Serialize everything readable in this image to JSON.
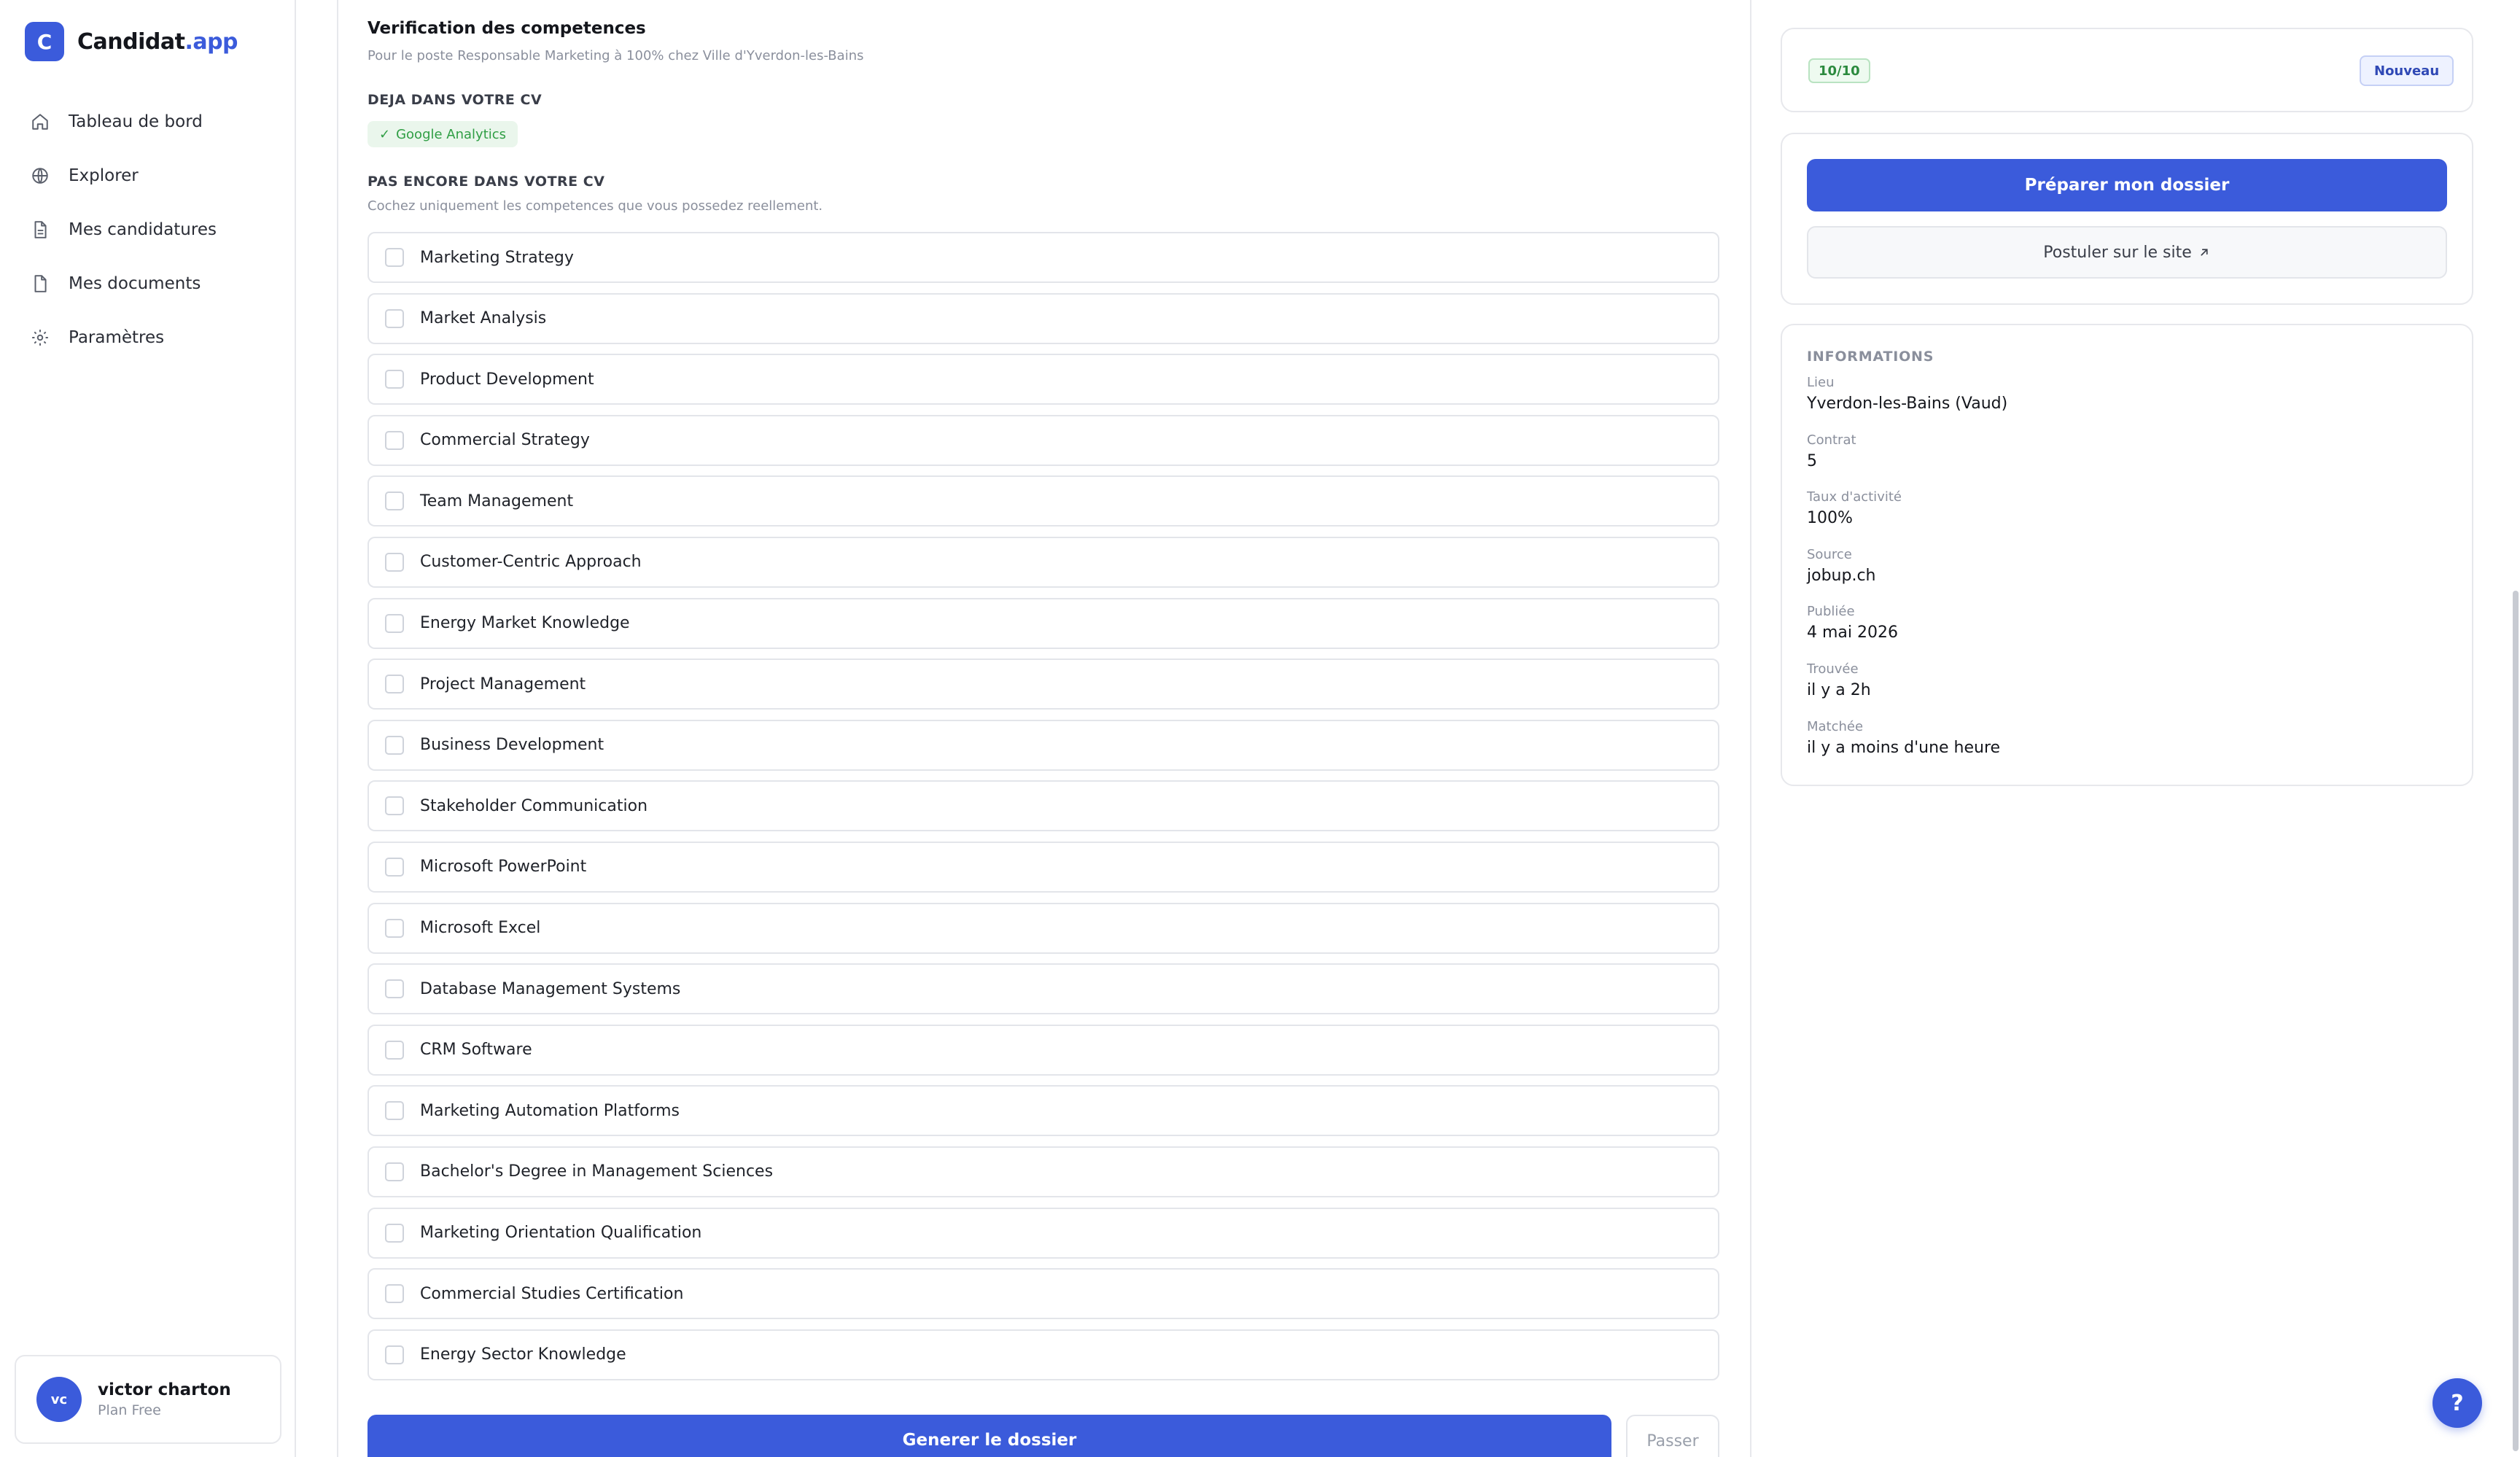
{
  "brand": {
    "logo_letter": "C",
    "name_main": "Candidat",
    "name_accent": ".app"
  },
  "nav": {
    "items": [
      {
        "label": "Tableau de bord",
        "icon": "home-icon"
      },
      {
        "label": "Explorer",
        "icon": "globe-icon"
      },
      {
        "label": "Mes candidatures",
        "icon": "file-text-icon"
      },
      {
        "label": "Mes documents",
        "icon": "file-icon"
      },
      {
        "label": "Paramètres",
        "icon": "gear-icon"
      }
    ]
  },
  "user": {
    "initials": "vc",
    "name": "victor charton",
    "plan": "Plan Free"
  },
  "verification": {
    "title": "Verification des competences",
    "subtitle": "Pour le poste Responsable Marketing à 100% chez Ville d'Yverdon-les-Bains",
    "in_cv_label": "DEJA DANS VOTRE CV",
    "in_cv_skills": [
      "Google Analytics"
    ],
    "not_in_cv_label": "PAS ENCORE DANS VOTRE CV",
    "hint": "Cochez uniquement les competences que vous possedez reellement.",
    "skills": [
      "Marketing Strategy",
      "Market Analysis",
      "Product Development",
      "Commercial Strategy",
      "Team Management",
      "Customer-Centric Approach",
      "Energy Market Knowledge",
      "Project Management",
      "Business Development",
      "Stakeholder Communication",
      "Microsoft PowerPoint",
      "Microsoft Excel",
      "Database Management Systems",
      "CRM Software",
      "Marketing Automation Platforms",
      "Bachelor's Degree in Management Sciences",
      "Marketing Orientation Qualification",
      "Commercial Studies Certification",
      "Energy Sector Knowledge"
    ],
    "generate_label": "Generer le dossier",
    "skip_label": "Passer"
  },
  "match": {
    "score": "10/10",
    "status": "Nouveau"
  },
  "actions": {
    "prepare_label": "Préparer mon dossier",
    "apply_label": "Postuler sur le site",
    "apply_icon": "external-link-icon"
  },
  "informations": {
    "title": "INFORMATIONS",
    "items": [
      {
        "key": "Lieu",
        "value": "Yverdon-les-Bains (Vaud)"
      },
      {
        "key": "Contrat",
        "value": "5"
      },
      {
        "key": "Taux d'activité",
        "value": "100%"
      },
      {
        "key": "Source",
        "value": "jobup.ch"
      },
      {
        "key": "Publiée",
        "value": "4 mai 2026"
      },
      {
        "key": "Trouvée",
        "value": "il y a 2h"
      },
      {
        "key": "Matchée",
        "value": "il y a moins d'une heure"
      }
    ]
  },
  "help": {
    "label": "?"
  },
  "colors": {
    "accent": "#3b5bdb",
    "success": "#2f9e44",
    "border": "#e7e8ec"
  }
}
